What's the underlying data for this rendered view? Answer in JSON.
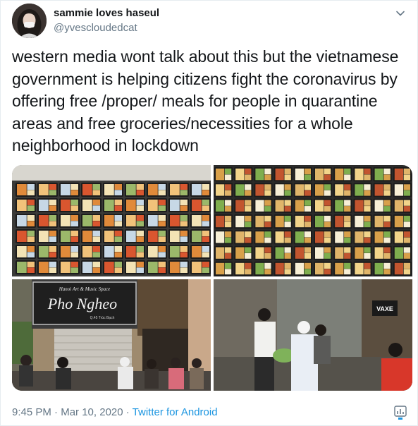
{
  "user": {
    "display_name": "sammie loves haseul",
    "handle": "@yvescloudedcat",
    "avatar": "avatar-photo"
  },
  "tweet": {
    "text": "western media wont talk about this but the vietnamese government is helping citizens fight the coronavirus by offering free /proper/ meals for people in quarantine areas and free groceries/necessities for a whole neighborhood in lockdown"
  },
  "media": {
    "photos": [
      {
        "name": "meal-boxes-photo-1"
      },
      {
        "name": "meal-boxes-photo-2"
      },
      {
        "name": "pho-ngheo-storefront-photo",
        "sign_small_top": "Hanoi Art & Music Space",
        "sign_main": "Pho Ngheo",
        "sign_small_bottom": "Q.45 Trùc Bạch"
      },
      {
        "name": "grocery-handout-photo",
        "sign": "VAXE"
      }
    ]
  },
  "footer": {
    "time": "9:45 PM",
    "separator_1": " · ",
    "date": "Mar 10, 2020",
    "separator_2": " · ",
    "source": "Twitter for Android"
  },
  "colors": {
    "link": "#1b95e0",
    "secondary_text": "#657786",
    "primary_text": "#14171a"
  },
  "icons": {
    "caret": "chevron-down-icon",
    "analytics": "analytics-icon"
  }
}
